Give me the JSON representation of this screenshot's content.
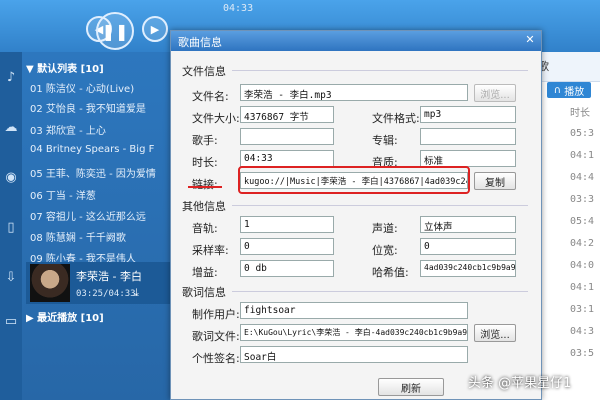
{
  "top": {
    "time": "04:33"
  },
  "playlist": {
    "header": "▼ 默认列表 [10]",
    "rows": [
      "01 陈洁仪 - 心动(Live)",
      "02 艾怡良 - 我不知道爱是",
      "03 郑欣宜 - 上心",
      "04 Britney Spears - Big F",
      "05 王菲、陈奕迅 - 因为爱情",
      "06 丁当 - 洋葱",
      "07 容祖儿 - 这么近那么远",
      "08 陈慧娴 - 千千阙歌",
      "09 陈小春 - 我不是伟人"
    ],
    "now_playing": {
      "title": "李荣浩 - 李白",
      "time": "03:25/04:33"
    },
    "footer": "▶ 最近播放 [10]"
  },
  "right": {
    "play_label": "播放",
    "col_header": "时长",
    "tab_label": "歌",
    "times": [
      "时长",
      "05:3",
      "04:1",
      "04:4",
      "03:3",
      "05:4",
      "04:2",
      "04:0",
      "04:1",
      "03:1",
      "04:3",
      "03:5"
    ]
  },
  "dialog": {
    "title": "歌曲信息",
    "close": "✕",
    "file_group": "文件信息",
    "labels": {
      "filename": "文件名:",
      "filesize": "文件大小:",
      "format": "文件格式:",
      "singer": "歌手:",
      "album": "专辑:",
      "duration": "时长:",
      "quality": "音质:",
      "link": "链接:"
    },
    "values": {
      "filename": "李荣浩 - 李白.mp3",
      "filesize": "4376867 字节",
      "format": "mp3",
      "singer": "",
      "album": "",
      "duration": "04:33",
      "quality": "标准",
      "link": "kugoo://|Music|李荣浩 - 李白|4376867|4ad039c240cb1"
    },
    "browse1": "浏览...",
    "copy": "复制",
    "other_group": "其他信息",
    "other_labels": {
      "track": "音轨:",
      "channel": "声道:",
      "samplerate": "采样率:",
      "bitrate": "位宽:",
      "gain": "增益:",
      "hash": "哈希值:"
    },
    "other_values": {
      "track": "1",
      "channel": "立体声",
      "samplerate": "0",
      "bitrate": "0",
      "gain": "0 db",
      "hash": "4ad039c240cb1c9b9a927"
    },
    "lyric_group": "歌词信息",
    "lyric_labels": {
      "maker": "制作用户:",
      "file": "歌词文件:",
      "sign": "个性签名:"
    },
    "lyric_values": {
      "maker": "fightsoar",
      "file": "E:\\KuGou\\Lyric\\李荣浩 - 李白-4ad039c240cb1c9b9a922",
      "sign": "Soar白"
    },
    "browse2": "浏览...",
    "refresh": "刷新"
  },
  "watermark": "头条 @苹果星仔1"
}
